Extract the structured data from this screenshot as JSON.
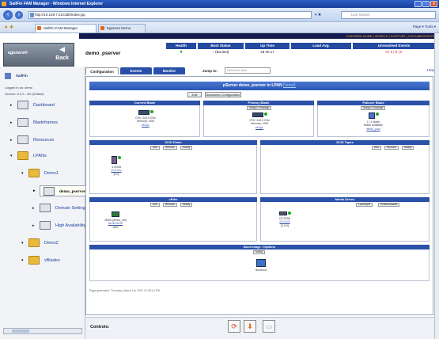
{
  "window": {
    "title": "SailFin FAM Manager - Windows Internet Explorer",
    "controls": [
      "_",
      "□",
      "x"
    ]
  },
  "browser": {
    "url": "http://10.129.7.21/cdtb/index.jsp",
    "refresh_label": "▾ ✖",
    "search_placeholder": "Live Search",
    "tabs": [
      "SailFin FAM Manager",
      "Egenera Demo"
    ],
    "command_bar": "Page ▾  Tools ▾"
  },
  "app": {
    "brand": "egenera®",
    "back_label": "Back",
    "top_links": "EGENERA HOME | SEARCH | SUPPORT | DOCUMENTATION",
    "host": "demo_pserver",
    "status_cols": [
      {
        "header": "Health",
        "value": "●"
      },
      {
        "header": "Boot Status",
        "value": "↑ (Booted)"
      },
      {
        "header": "Up Time",
        "value": "2d 00:17"
      },
      {
        "header": "Load Avg.",
        "value": ""
      },
      {
        "header": "Unresolved Events",
        "value": "0 | 0 | 0 | 0"
      }
    ]
  },
  "sidebar": {
    "user": "SailFin",
    "login": "Logged in as: demo",
    "version": "Version: 5.2.0 - 4D (Default)",
    "items": [
      {
        "label": "Dashboard",
        "indent": 0,
        "type": "node"
      },
      {
        "label": "Bladeframes",
        "indent": 0,
        "type": "node"
      },
      {
        "label": "Resources",
        "indent": 0,
        "type": "node"
      },
      {
        "label": "LPANs",
        "indent": 0,
        "type": "folder"
      },
      {
        "label": "Demo1",
        "indent": 1,
        "type": "folder"
      },
      {
        "label": "demo_pserver",
        "indent": 2,
        "type": "sel"
      },
      {
        "label": "Domain Settings",
        "indent": 2,
        "type": "node"
      },
      {
        "label": "High Availability",
        "indent": 2,
        "type": "node"
      },
      {
        "label": "Demo2",
        "indent": 1,
        "type": "folder"
      },
      {
        "label": "vBlades",
        "indent": 1,
        "type": "folder"
      }
    ]
  },
  "main": {
    "tabs": [
      "Configuration",
      "Events",
      "Monitor"
    ],
    "jump_label": "Jump to:",
    "jump_placeholder": "Select an item",
    "help": "Help",
    "panel_title": "pServer demo_pserver in LPAN",
    "panel_title_link": "Demo1",
    "edit_label": "Edit",
    "advanced_label": "Advanced Configuration",
    "sections": {
      "current_blade": {
        "title": "Current Blade",
        "line1": "CPU: 2x3.0 GHz",
        "line2": "Memory: 4GB",
        "link": "bf1\\p1"
      },
      "primary_blade": {
        "title": "Primary Blade",
        "btn": "Assign | Unassign",
        "line1": "CPU: 2x3.0 GHz",
        "line2": "Memory: 4GB",
        "link": "bf1\\p1"
      },
      "failover_blade": {
        "title": "Failover Blade",
        "btn": "Assign | Unassign",
        "line1": "1 / 1 blade",
        "line2": "Blade available",
        "link": "demo_pool"
      },
      "scsi_disks": {
        "title": "SCSI Disks",
        "btns": [
          "Add",
          "Remove",
          "Modify"
        ],
        "name": "4.00GB",
        "sub": "(0,0,0,0)",
        "label": "[0,0]"
      },
      "scsi_tapes": {
        "title": "SCSI Tapes",
        "btns": [
          "Add",
          "Remove",
          "Modify"
        ]
      },
      "veths": {
        "title": "vEths",
        "btns": [
          "Add",
          "Remove",
          "Modify"
        ],
        "name": "vEth0 (demo_net)",
        "sub": "0e:00:00:00",
        "label": "eth0"
      },
      "media_drives": {
        "title": "Media Drives",
        "btns": [
          "Load/Eject",
          "Enable/Disable"
        ],
        "name": "CD-ROM",
        "sub": "(1,0,0,0)",
        "label": "[2,0,0]"
      },
      "boot_image": {
        "title": "Boot Image / Options",
        "btn": "Modify",
        "label": "linuxboot"
      }
    },
    "footer": "Page generated: Thursday, March 1st, 2007 01:35:14 PM"
  },
  "controls": {
    "label": "Controls:"
  },
  "colors": {
    "header_blue": "#2b52a8",
    "nav_dark": "#151a4e",
    "health_green": "#21a822"
  }
}
